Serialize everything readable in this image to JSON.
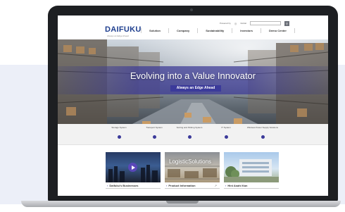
{
  "site": {
    "logo": "DAIFUKU",
    "tagline": "Always an Edge Ahead"
  },
  "utility": {
    "powered_by": "Powered by",
    "language": "Global",
    "search_placeholder": "",
    "search_icon": "search-icon"
  },
  "nav": {
    "items": [
      {
        "label": "Solution"
      },
      {
        "label": "Company"
      },
      {
        "label": "Sustainability"
      },
      {
        "label": "Investors"
      },
      {
        "label": "Demo Center"
      }
    ]
  },
  "hero": {
    "title": "Evolving into a Value Innovator",
    "subtitle": "Always an Edge Ahead"
  },
  "categories": [
    {
      "label": "Storage System"
    },
    {
      "label": "Transport System"
    },
    {
      "label": "Sorting and Picking System"
    },
    {
      "label": "IT System"
    },
    {
      "label": "Wireless Power Supply Solutions"
    }
  ],
  "cards": [
    {
      "caption": "Daifuku's Businesses",
      "icon": "play-icon"
    },
    {
      "caption": "Product Information",
      "image_text": "LogisticSolutions"
    },
    {
      "caption": "Hini Asahi Kan"
    }
  ],
  "colors": {
    "brand": "#1f3f8f",
    "accent": "#3b3a9a",
    "laptop_frame": "#1d1f22"
  }
}
